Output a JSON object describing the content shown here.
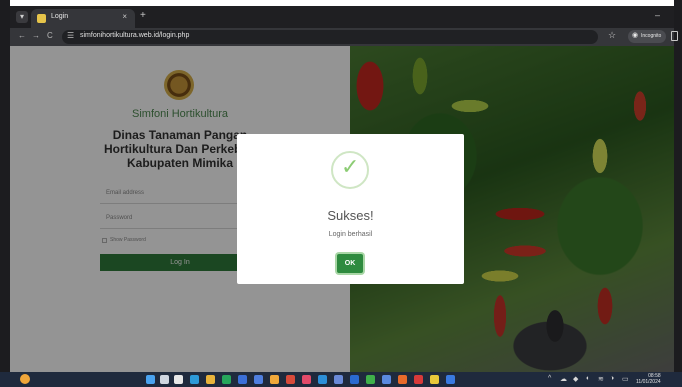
{
  "browser": {
    "tab_title": "Login",
    "tab_close": "×",
    "new_tab": "+",
    "minimize": "–",
    "url": "simfonihortikultura.web.id/login.php",
    "incognito_label": "Incognito"
  },
  "login": {
    "brand": "Simfoni Hortikultura",
    "org_line1": "Dinas Tanaman Pangan",
    "org_line2": "Hortikultura Dan Perkebun",
    "org_line3": "Kabupaten Mimika",
    "email_placeholder": "Email address",
    "password_placeholder": "Password",
    "show_password_label": "Show Password",
    "login_button": "Log In"
  },
  "modal": {
    "title": "Sukses!",
    "message": "Login berhasil",
    "ok_button": "OK"
  },
  "taskbar": {
    "time": "08:58",
    "date": "11/01/2024"
  }
}
